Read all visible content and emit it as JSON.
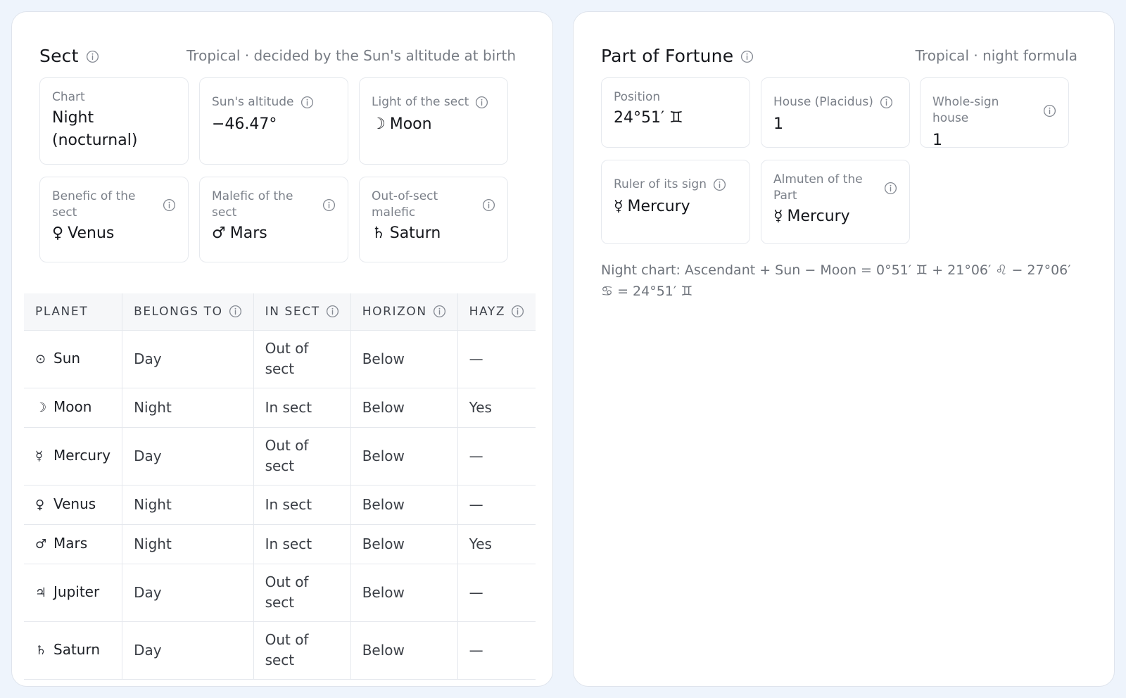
{
  "sect": {
    "title": "Sect",
    "subtitle": "Tropical · decided by the Sun's altitude at birth",
    "cards": [
      {
        "label": "Chart",
        "value": "Night (nocturnal)",
        "glyph": ""
      },
      {
        "label": "Sun's altitude",
        "value": "−46.47°",
        "glyph": ""
      },
      {
        "label": "Light of the sect",
        "value": "Moon",
        "glyph": "☽"
      },
      {
        "label": "Benefic of the sect",
        "value": "Venus",
        "glyph": "♀"
      },
      {
        "label": "Malefic of the sect",
        "value": "Mars",
        "glyph": "♂"
      },
      {
        "label": "Out-of-sect malefic",
        "value": "Saturn",
        "glyph": "♄"
      }
    ],
    "table": {
      "headers": [
        "PLANET",
        "BELONGS TO",
        "IN SECT",
        "HORIZON",
        "HAYZ"
      ],
      "rows": [
        {
          "glyph": "⊙",
          "planet": "Sun",
          "belongs": "Day",
          "in_sect": "Out of sect",
          "horizon": "Below",
          "hayz": "—"
        },
        {
          "glyph": "☽",
          "planet": "Moon",
          "belongs": "Night",
          "in_sect": "In sect",
          "horizon": "Below",
          "hayz": "Yes"
        },
        {
          "glyph": "☿",
          "planet": "Mercury",
          "belongs": "Day",
          "in_sect": "Out of sect",
          "horizon": "Below",
          "hayz": "—"
        },
        {
          "glyph": "♀",
          "planet": "Venus",
          "belongs": "Night",
          "in_sect": "In sect",
          "horizon": "Below",
          "hayz": "—"
        },
        {
          "glyph": "♂",
          "planet": "Mars",
          "belongs": "Night",
          "in_sect": "In sect",
          "horizon": "Below",
          "hayz": "Yes"
        },
        {
          "glyph": "♃",
          "planet": "Jupiter",
          "belongs": "Day",
          "in_sect": "Out of sect",
          "horizon": "Below",
          "hayz": "—"
        },
        {
          "glyph": "♄",
          "planet": "Saturn",
          "belongs": "Day",
          "in_sect": "Out of sect",
          "horizon": "Below",
          "hayz": "—"
        }
      ]
    }
  },
  "fortune": {
    "title": "Part of Fortune",
    "subtitle": "Tropical · night formula",
    "cards": [
      {
        "label": "Position",
        "value": "24°51′ ♊",
        "glyph": ""
      },
      {
        "label": "House (Placidus)",
        "value": "1",
        "glyph": ""
      },
      {
        "label": "Whole-sign house",
        "value": "1",
        "glyph": ""
      },
      {
        "label": "Ruler of its sign",
        "value": "Mercury",
        "glyph": "☿"
      },
      {
        "label": "Almuten of the Part",
        "value": "Mercury",
        "glyph": "☿"
      }
    ],
    "formula": "Night chart: Ascendant + Sun − Moon = 0°51′ ♊ + 21°06′ ♌ − 27°06′ ♋ = 24°51′ ♊"
  },
  "colors": {
    "background": "#eef4fc",
    "accent": "#1d5a96",
    "muted_text": "#777c84"
  }
}
